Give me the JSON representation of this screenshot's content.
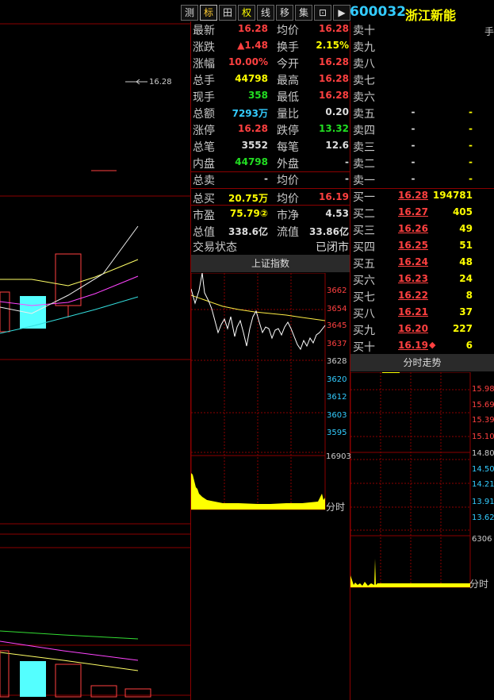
{
  "toolbar": {
    "buttons": [
      "测",
      "标",
      "田",
      "权",
      "线",
      "移",
      "集",
      "⊡",
      "▶"
    ],
    "active": "标"
  },
  "stock": {
    "code": "600032",
    "name": "浙江新能"
  },
  "left_chart": {
    "price_marker": "16.28"
  },
  "quote": {
    "rows": [
      {
        "l1": "最新",
        "v1": "16.28",
        "c1": "red",
        "l2": "均价",
        "v2": "16.28",
        "c2": "red"
      },
      {
        "l1": "涨跌",
        "v1": "▲1.48",
        "c1": "red",
        "l2": "换手",
        "v2": "2.15%",
        "c2": "yellow"
      },
      {
        "l1": "涨幅",
        "v1": "10.00%",
        "c1": "red",
        "l2": "今开",
        "v2": "16.28",
        "c2": "red"
      },
      {
        "l1": "总手",
        "v1": "44798",
        "c1": "yellow",
        "l2": "最高",
        "v2": "16.28",
        "c2": "red"
      },
      {
        "l1": "现手",
        "v1": "358",
        "c1": "grn2",
        "l2": "最低",
        "v2": "16.28",
        "c2": "red"
      },
      {
        "l1": "总额",
        "v1": "7293万",
        "c1": "cyan",
        "l2": "量比",
        "v2": "0.20",
        "c2": "white"
      },
      {
        "l1": "涨停",
        "v1": "16.28",
        "c1": "red",
        "l2": "跌停",
        "v2": "13.32",
        "c2": "grn2"
      },
      {
        "l1": "总笔",
        "v1": "3552",
        "c1": "white",
        "l2": "每笔",
        "v2": "12.6",
        "c2": "white"
      },
      {
        "l1": "内盘",
        "v1": "44798",
        "c1": "grn2",
        "l2": "外盘",
        "v2": "-",
        "c2": "white"
      },
      {
        "l1": "总卖",
        "v1": "-",
        "c1": "white",
        "l2": "均价",
        "v2": "-",
        "c2": "white"
      },
      {
        "l1": "总买",
        "v1": "20.75万",
        "c1": "yellow",
        "l2": "均价",
        "v2": "16.19",
        "c2": "red"
      },
      {
        "l1": "市盈",
        "v1": "75.79②",
        "c1": "yellow",
        "l2": "市净",
        "v2": "4.53",
        "c2": "white"
      },
      {
        "l1": "总值",
        "v1": "338.6亿",
        "c1": "white",
        "l2": "流值",
        "v2": "33.86亿",
        "c2": "white"
      }
    ],
    "status_label": "交易状态",
    "status_value": "已闭市"
  },
  "index_chart": {
    "title": "上证指数",
    "price_ticks": [
      "3662",
      "3654",
      "3645",
      "3637",
      "3628",
      "3620",
      "3612",
      "3603",
      "3595"
    ],
    "vol_max": "16903",
    "time_label": "分时"
  },
  "order_book": {
    "unit": "手",
    "sells": [
      {
        "label": "卖十",
        "price": "",
        "qty": ""
      },
      {
        "label": "卖九",
        "price": "",
        "qty": ""
      },
      {
        "label": "卖八",
        "price": "",
        "qty": ""
      },
      {
        "label": "卖七",
        "price": "",
        "qty": ""
      },
      {
        "label": "卖六",
        "price": "",
        "qty": ""
      },
      {
        "label": "卖五",
        "price": "-",
        "qty": "-"
      },
      {
        "label": "卖四",
        "price": "-",
        "qty": "-"
      },
      {
        "label": "卖三",
        "price": "-",
        "qty": "-"
      },
      {
        "label": "卖二",
        "price": "-",
        "qty": "-"
      },
      {
        "label": "卖一",
        "price": "-",
        "qty": "-"
      }
    ],
    "buys": [
      {
        "label": "买一",
        "price": "16.28",
        "qty": "194781"
      },
      {
        "label": "买二",
        "price": "16.27",
        "qty": "405"
      },
      {
        "label": "买三",
        "price": "16.26",
        "qty": "49"
      },
      {
        "label": "买四",
        "price": "16.25",
        "qty": "51"
      },
      {
        "label": "买五",
        "price": "16.24",
        "qty": "48"
      },
      {
        "label": "买六",
        "price": "16.23",
        "qty": "24"
      },
      {
        "label": "买七",
        "price": "16.22",
        "qty": "8"
      },
      {
        "label": "买八",
        "price": "16.21",
        "qty": "37"
      },
      {
        "label": "买九",
        "price": "16.20",
        "qty": "227"
      },
      {
        "label": "买十",
        "price": "16.19",
        "qty": "6",
        "marker": "◆"
      }
    ]
  },
  "intraday_chart": {
    "title": "分时走势",
    "price_ticks": [
      "15.98",
      "15.69",
      "15.39",
      "15.10",
      "14.80",
      "14.50",
      "14.21",
      "13.91",
      "13.62"
    ],
    "vol_max": "6306",
    "time_label": "分时"
  },
  "colors": {
    "up": "#ff4040",
    "down": "#33ff33",
    "grid": "#8b0000",
    "candle_up": "#ff4040",
    "candle_down": "#54ffff"
  }
}
